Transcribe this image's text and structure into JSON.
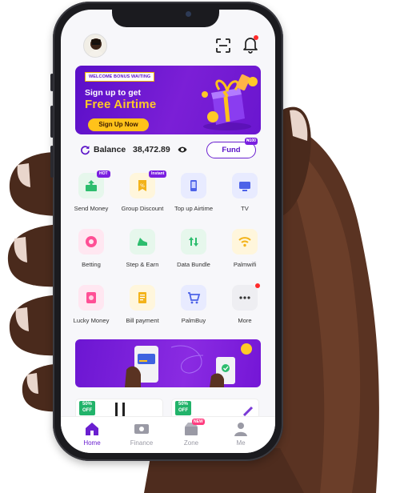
{
  "header": {
    "avatar": "user-avatar",
    "scan_icon": "scan-icon",
    "bell_icon": "bell-icon"
  },
  "banner": {
    "tag": "WELCOME BONUS WAITING",
    "line1": "Sign up to get",
    "line2": "Free Airtime",
    "button": "Sign Up Now"
  },
  "balance": {
    "label": "Balance",
    "value": "38,472.89",
    "fund_label": "Fund",
    "fund_badge": "₦100"
  },
  "services": [
    {
      "label": "Send Money",
      "badge": "HOT",
      "icon": "send-money-icon",
      "bg": "#e6f7ec",
      "color": "#2dbd6e"
    },
    {
      "label": "Group Discount",
      "badge": "Instant",
      "icon": "discount-tag-icon",
      "bg": "#fff6dc",
      "color": "#f3b31a"
    },
    {
      "label": "Top up Airtime",
      "badge": "",
      "icon": "phone-icon",
      "bg": "#e8ebff",
      "color": "#4d63e8"
    },
    {
      "label": "TV",
      "badge": "",
      "icon": "tv-icon",
      "bg": "#e8ebff",
      "color": "#4d63e8"
    },
    {
      "label": "Betting",
      "badge": "",
      "icon": "betting-icon",
      "bg": "#ffe7f1",
      "color": "#ff4f95"
    },
    {
      "label": "Step & Earn",
      "badge": "",
      "icon": "shoe-icon",
      "bg": "#e6f7ec",
      "color": "#2dbd6e"
    },
    {
      "label": "Data Bundle",
      "badge": "",
      "icon": "data-arrows-icon",
      "bg": "#e6f7ec",
      "color": "#2dbd6e"
    },
    {
      "label": "Palmwifi",
      "badge": "",
      "icon": "wifi-icon",
      "bg": "#fff6dc",
      "color": "#f3b31a"
    },
    {
      "label": "Lucky Money",
      "badge": "",
      "icon": "lucky-money-icon",
      "bg": "#ffe7f1",
      "color": "#ff4f95"
    },
    {
      "label": "Bill payment",
      "badge": "",
      "icon": "bill-icon",
      "bg": "#fff6dc",
      "color": "#f3b31a"
    },
    {
      "label": "PalmBuy",
      "badge": "",
      "icon": "cart-icon",
      "bg": "#e8ebff",
      "color": "#4d63e8"
    },
    {
      "label": "More",
      "badge": "",
      "icon": "more-dots-icon",
      "bg": "#eeeef2",
      "color": "#333333",
      "dot": true
    }
  ],
  "cards": [
    {
      "tag": "50%",
      "tag2": "OFF"
    },
    {
      "tag": "50%",
      "tag2": "OFF"
    }
  ],
  "nav": [
    {
      "label": "Home",
      "icon": "home-icon",
      "active": true
    },
    {
      "label": "Finance",
      "icon": "finance-icon",
      "active": false
    },
    {
      "label": "Zone",
      "icon": "zone-icon",
      "active": false,
      "badge": "NEW"
    },
    {
      "label": "Me",
      "icon": "person-icon",
      "active": false
    }
  ],
  "colors": {
    "brand": "#6a1fd0",
    "accent": "#ffc21a",
    "alert": "#ff2a2a"
  }
}
